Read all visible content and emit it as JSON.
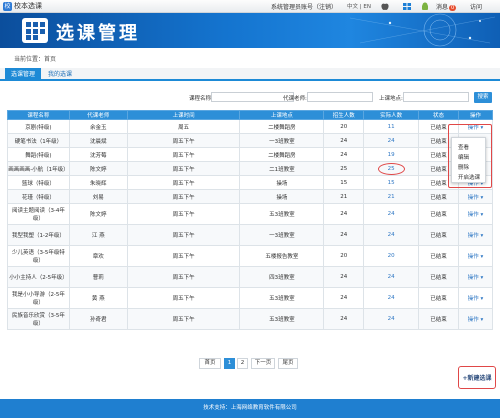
{
  "topbar": {
    "brand": "校本选课",
    "account": "系统管理员账号（注销）",
    "lang": "中文 | EN",
    "messages_label": "消息",
    "messages_count": "0",
    "visit_label": "访问"
  },
  "banner": {
    "title": "选课管理"
  },
  "breadcrumb": "当前位置：首页",
  "tabs": [
    {
      "label": "选课管理"
    },
    {
      "label": "我的选课"
    }
  ],
  "search": {
    "course_label": "课程名称:",
    "teacher_label": "代课老师:",
    "place_label": "上课地点:",
    "button": "搜索"
  },
  "table": {
    "headers": [
      "课程名称",
      "代课老师",
      "上课时间",
      "上课地点",
      "招生人数",
      "实际人数",
      "状态",
      "操作"
    ],
    "rows": [
      {
        "name": "京剧(特级)",
        "teacher": "余金玉",
        "time": "周五",
        "place": "二楼舞蹈房",
        "quota": "20",
        "actual": "11",
        "status": "已结束",
        "op": "操作"
      },
      {
        "name": "硬笔书法（1年级）",
        "teacher": "沈晨斌",
        "time": "周五下午",
        "place": "一3班教室",
        "quota": "24",
        "actual": "24",
        "status": "已结束",
        "op": "操作"
      },
      {
        "name": "舞蹈(特级)",
        "teacher": "沈芳莓",
        "time": "周五下午",
        "place": "二楼舞蹈房",
        "quota": "24",
        "actual": "19",
        "status": "已结束",
        "op": "操作"
      },
      {
        "name": "画画画画-小航（1年级）",
        "teacher": "陈文婷",
        "time": "周五下午",
        "place": "二1班教室",
        "quota": "25",
        "actual": "25",
        "status": "已结束",
        "op": "操作"
      },
      {
        "name": "篮球（特级）",
        "teacher": "朱晓辉",
        "time": "周五下午",
        "place": "操场",
        "quota": "15",
        "actual": "15",
        "status": "已结束",
        "op": "操作"
      },
      {
        "name": "花瑾（特级）",
        "teacher": "刘易",
        "time": "周五下午",
        "place": "操场",
        "quota": "21",
        "actual": "21",
        "status": "已结束",
        "op": "操作"
      },
      {
        "name": "阅读主题阅读（3-4年级）",
        "teacher": "陈文婷",
        "time": "周五下午",
        "place": "五3班教室",
        "quota": "24",
        "actual": "24",
        "status": "已结束",
        "op": "操作"
      },
      {
        "name": "我型我塑（1-2年级）",
        "teacher": "江 燕",
        "time": "周五下午",
        "place": "一3班教室",
        "quota": "24",
        "actual": "24",
        "status": "已结束",
        "op": "操作"
      },
      {
        "name": "少儿英语（3-5年级特级）",
        "teacher": "章欢",
        "time": "周五下午",
        "place": "五楼报告教室",
        "quota": "20",
        "actual": "20",
        "status": "已结束",
        "op": "操作"
      },
      {
        "name": "小小主持人（2-5年级）",
        "teacher": "曹莉",
        "time": "周五下午",
        "place": "四3班教室",
        "quota": "24",
        "actual": "24",
        "status": "已结束",
        "op": "操作"
      },
      {
        "name": "我是小小导游（2-5年级）",
        "teacher": "黄 燕",
        "time": "周五下午",
        "place": "五3班教室",
        "quota": "24",
        "actual": "24",
        "status": "已结束",
        "op": "操作"
      },
      {
        "name": "民族音乐欣赏（3-5年级）",
        "teacher": "孙奇君",
        "time": "周五下午",
        "place": "五3班教室",
        "quota": "24",
        "actual": "24",
        "status": "已结束",
        "op": "操作"
      }
    ]
  },
  "menu": {
    "items": [
      "查看",
      "编辑",
      "删除",
      "开启选课"
    ]
  },
  "pager": {
    "first": "首页",
    "p1": "1",
    "p2": "2",
    "next": "下一页",
    "last": "尾页"
  },
  "new_course": "新建选课",
  "footer": "技术支持：上海网络教育软件有限公司",
  "colors": {
    "primary": "#2d8fd8",
    "banner": "#1474cf",
    "highlight": "#e04848"
  }
}
